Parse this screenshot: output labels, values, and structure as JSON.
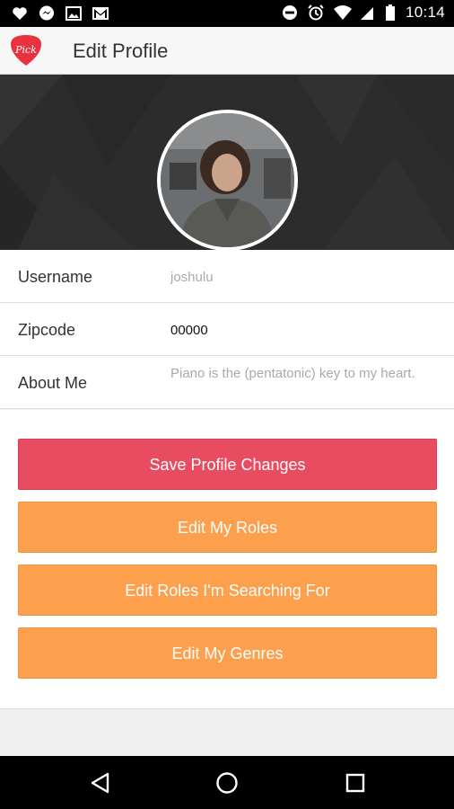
{
  "status_bar": {
    "time": "10:14",
    "left_icons": [
      "heart-icon",
      "messenger-icon",
      "image-icon",
      "gmail-icon"
    ],
    "right_icons": [
      "do-not-disturb-icon",
      "alarm-icon",
      "wifi-icon",
      "cell-signal-icon",
      "battery-icon"
    ]
  },
  "app_bar": {
    "logo_text": "Pick",
    "title": "Edit Profile"
  },
  "profile": {
    "fields": [
      {
        "label": "Username",
        "value": "joshulu",
        "is_placeholder": true
      },
      {
        "label": "Zipcode",
        "value": "00000",
        "is_placeholder": false
      },
      {
        "label": "About Me",
        "value": "Piano is the (pentatonic) key to my heart.",
        "is_placeholder": true
      }
    ]
  },
  "actions": {
    "save": "Save Profile Changes",
    "edit_roles": "Edit My Roles",
    "edit_searching": "Edit Roles I'm Searching For",
    "edit_genres": "Edit My Genres"
  },
  "colors": {
    "primary_button": "#e84c61",
    "secondary_button": "#fca04d",
    "header_bg": "#2d2d2d"
  }
}
